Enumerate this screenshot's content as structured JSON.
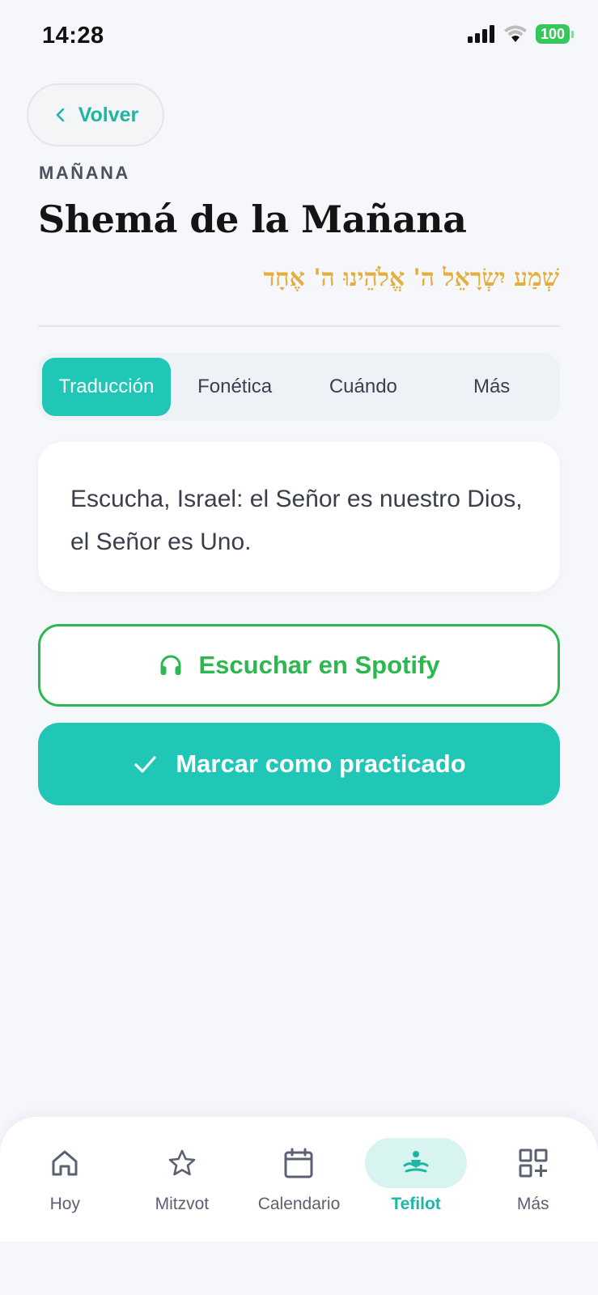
{
  "status_bar": {
    "time": "14:28",
    "battery": "100",
    "icons": [
      "signal-icon",
      "wifi-icon",
      "battery-icon"
    ]
  },
  "header": {
    "back_label": "Volver",
    "section_label": "MAÑANA",
    "title": "Shemá de la Mañana",
    "hebrew": "שְׁמַע יִשְׂרָאֵל ה' אֱלֹהֵינוּ ה' אֶחָד"
  },
  "tabs": [
    {
      "label": "Traducción",
      "active": true
    },
    {
      "label": "Fonética",
      "active": false
    },
    {
      "label": "Cuándo",
      "active": false
    },
    {
      "label": "Más",
      "active": false
    }
  ],
  "translation": {
    "text": "Escucha, Israel: el Señor es nuestro Dios, el Señor es Uno."
  },
  "actions": {
    "spotify_label": "Escuchar en Spotify",
    "practice_label": "Marcar como practicado"
  },
  "bottom_nav": [
    {
      "label": "Hoy",
      "icon": "home-icon",
      "active": false
    },
    {
      "label": "Mitzvot",
      "icon": "star-icon",
      "active": false
    },
    {
      "label": "Calendario",
      "icon": "calendar-icon",
      "active": false
    },
    {
      "label": "Tefilot",
      "icon": "prayer-icon",
      "active": true
    },
    {
      "label": "Más",
      "icon": "grid-plus-icon",
      "active": false
    }
  ],
  "colors": {
    "accent": "#21c7b6",
    "spotify_green": "#2cb84f",
    "hebrew_gold": "#e4ae3d",
    "background": "#f5f7fb"
  }
}
